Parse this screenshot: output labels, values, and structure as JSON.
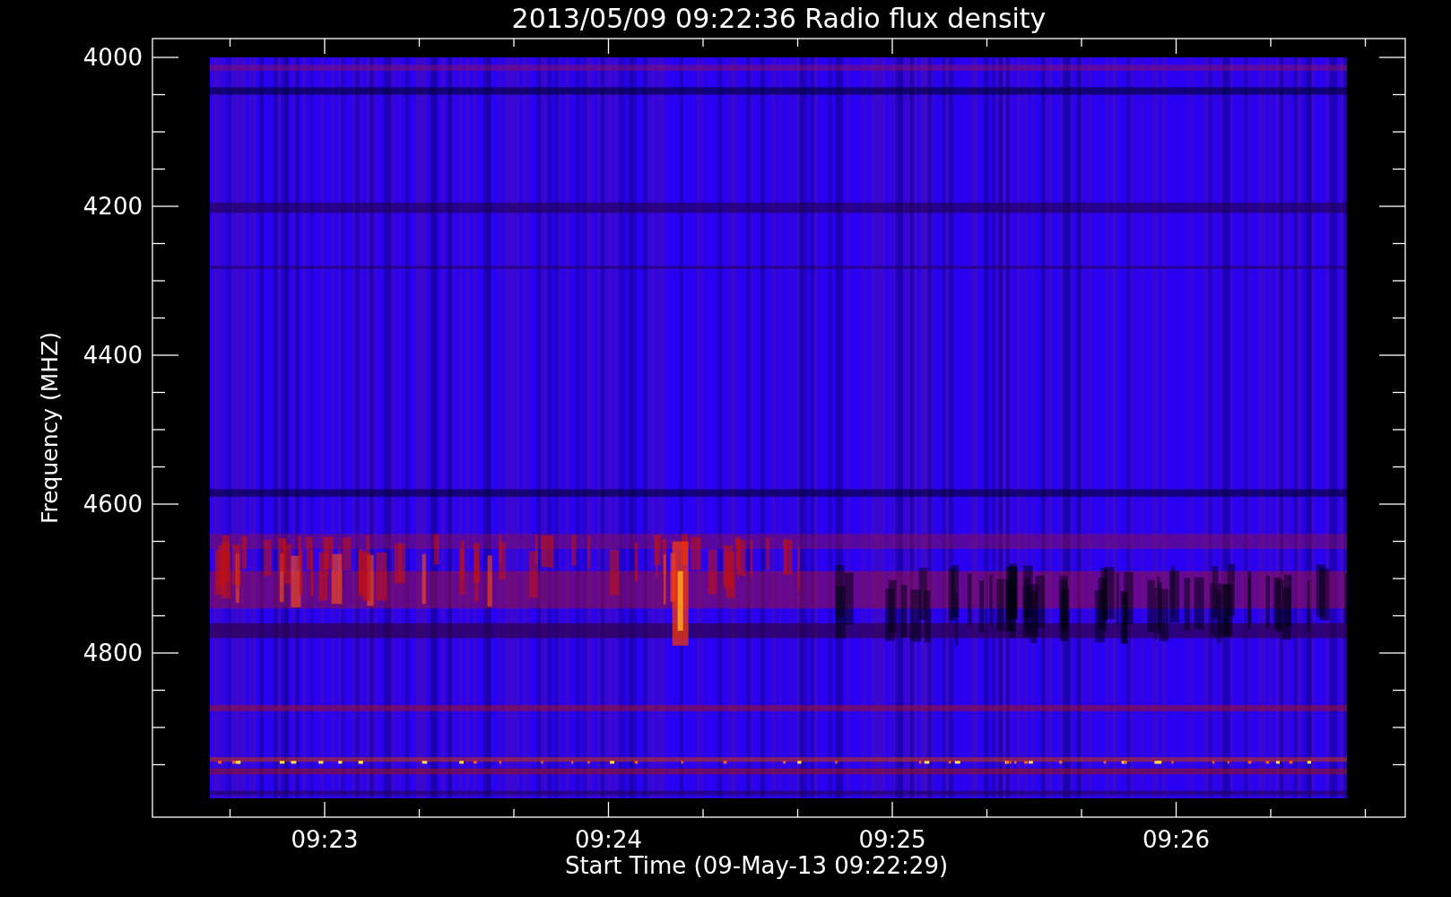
{
  "plot": {
    "title": "2013/05/09 09:22:36 Radio flux density",
    "y_axis": {
      "label": "Frequency (MHZ)",
      "ticks": [
        "4000",
        "4200",
        "4400",
        "4600",
        "4800"
      ]
    },
    "x_axis": {
      "label": "Start Time (09-May-13 09:22:29)",
      "ticks": [
        "09:23",
        "09:24",
        "09:25",
        "09:26"
      ]
    }
  }
}
